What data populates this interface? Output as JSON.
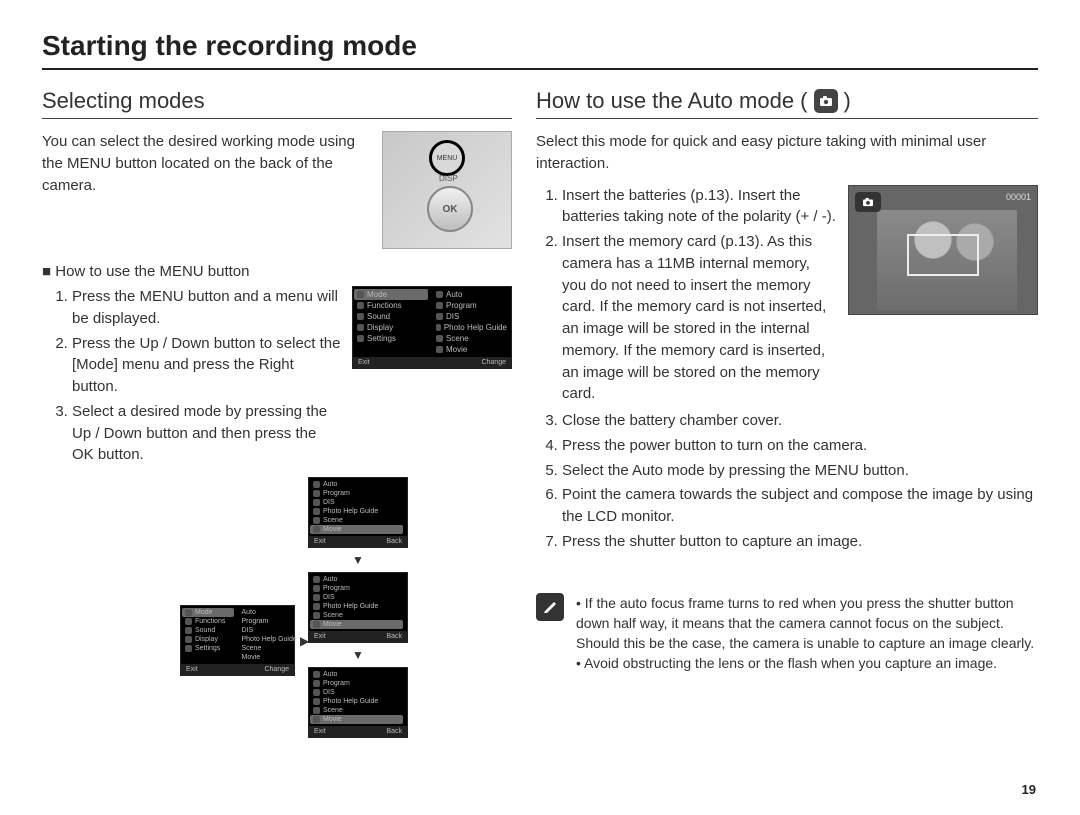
{
  "page_title": "Starting the recording mode",
  "page_number": "19",
  "left": {
    "section_title": "Selecting modes",
    "intro": "You can select the desired working mode using the MENU button located on the back of the camera.",
    "camera_back": {
      "menu_label": "MENU",
      "disp_label": "DISP",
      "ok_label": "OK"
    },
    "howto_head": "How to use the MENU button",
    "steps": [
      "Press the MENU button and a menu will be displayed.",
      "Press the Up / Down button to select the [Mode] menu and press the Right button.",
      "Select a desired mode by pressing the Up / Down button and then press the OK button."
    ],
    "menu_left_items": [
      "Mode",
      "Functions",
      "Sound",
      "Display",
      "Settings"
    ],
    "menu_right_items": [
      "Auto",
      "Program",
      "DIS",
      "Photo Help Guide",
      "Scene",
      "Movie"
    ],
    "menu_right_selected": "Movie",
    "menu_bar_left": "Exit",
    "menu_bar_right": "Change",
    "menu_bar_back": "Back"
  },
  "right": {
    "section_title_pre": "How to use the Auto mode (",
    "section_title_post": ")",
    "intro": "Select this mode for quick and easy picture taking with minimal user interaction.",
    "lcd_status": "00001",
    "steps": [
      "Insert the batteries (p.13). Insert the batteries taking note of the polarity (+ / -).",
      "Insert the memory card (p.13). As this camera has a 11MB internal memory, you do not need to insert the memory card. If the memory card is not inserted, an image will be stored in the internal memory. If the memory card is inserted, an image will be stored on the memory card.",
      "Close the battery chamber cover.",
      "Press the power button to turn on the camera.",
      "Select the Auto mode by pressing the MENU button.",
      "Point the camera towards the subject and compose the image by using the LCD monitor.",
      "Press the shutter button to capture an image."
    ],
    "notes": [
      "If the auto focus frame turns to red when you press the shutter button down half way, it means that the camera cannot focus on the subject. Should this be the case, the camera is unable to capture an image clearly.",
      "Avoid obstructing the lens or the flash when you capture an image."
    ]
  }
}
